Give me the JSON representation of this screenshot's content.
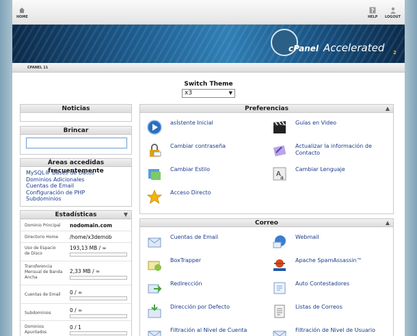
{
  "header": {
    "home_label": "HOME",
    "help_label": "HELP",
    "logout_label": "LOGOUT"
  },
  "banner": {
    "brand_main": "cPanel",
    "brand_sub": "Accelerated",
    "brand_version": "2"
  },
  "breadcrumb": "CPANEL 11",
  "theme": {
    "label": "Switch Theme",
    "selected": "x3"
  },
  "left": {
    "noticias_title": "Noticias",
    "brincar_title": "Brincar",
    "freq_title": "Áreas accedidas frecuentemente",
    "freq_links": [
      "MySQL® Bases de Datos",
      "Dominios Adicionales",
      "Cuentas de Email",
      "Configuración de PHP",
      "Subdominios"
    ],
    "stats_title": "Estadísticas",
    "stats": [
      {
        "label": "Dominio Principal",
        "value": "nodomain.com"
      },
      {
        "label": "Directorio Home",
        "value": "/home/x3demob"
      },
      {
        "label": "Uso de Espacio de Disco",
        "value": "193,13 MB / ∞"
      },
      {
        "label": "Transferencia Mensual de Banda Ancha",
        "value": "2,33 MB / ∞"
      },
      {
        "label": "Cuentas de Email",
        "value": "0 / ∞"
      },
      {
        "label": "Subdominios",
        "value": "0 / ∞"
      },
      {
        "label": "Dominios Apuntados",
        "value": "0 / 1"
      }
    ]
  },
  "preferencias": {
    "title": "Preferencias",
    "items": [
      "asÍstente Inicial",
      "Guías en Video",
      "Cambiar contraseña",
      "Actualizar la información de Contacto",
      "Cambiar Estilo",
      "Cambiar Lenguaje",
      "Acceso Directo"
    ]
  },
  "correo": {
    "title": "Correo",
    "items": [
      "Cuentas de Email",
      "Webmail",
      "BoxTrapper",
      "Apache SpamAssassin™",
      "Redirección",
      "Auto Contestadores",
      "Dirección por Defecto",
      "Listas de Correos",
      "Filtración al Nivel de Cuenta",
      "Filtración de Nivel de Usuario"
    ]
  },
  "colors": {
    "link": "#1a3b8a",
    "banner": "#1c5a8c",
    "accent": "#ffb400"
  }
}
